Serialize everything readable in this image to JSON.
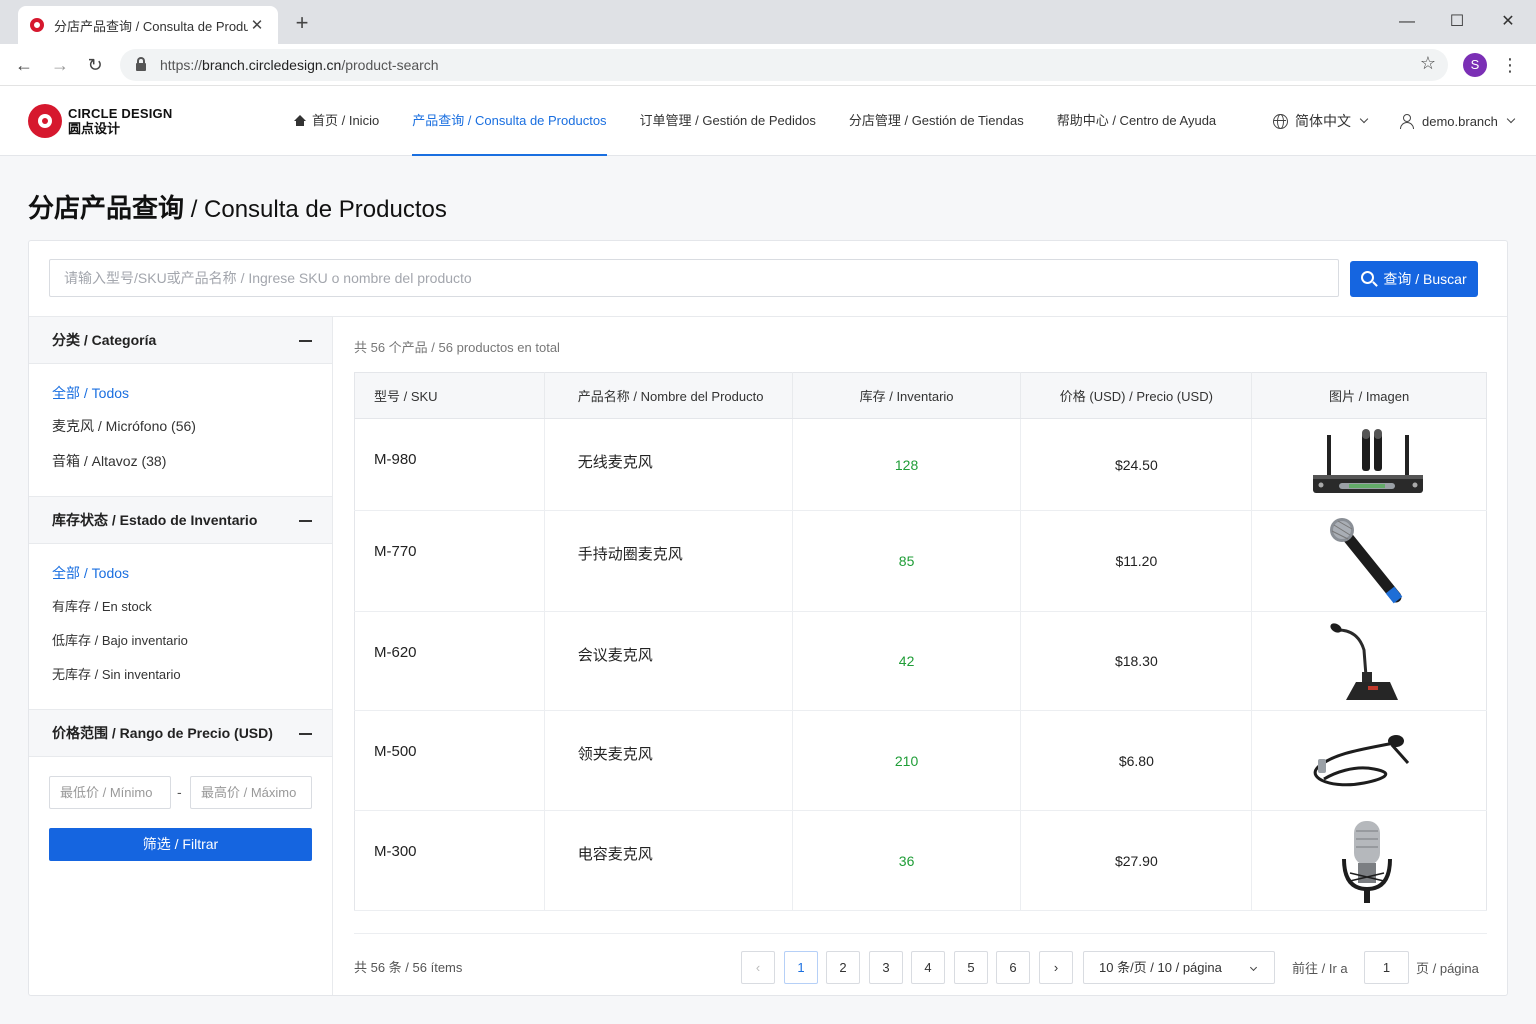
{
  "browser": {
    "tab_title": "分店产品查询 / Consulta de Productos",
    "url_prefix": "https://",
    "url_host": "branch.circledesign.cn",
    "url_path": "/product-search",
    "profile_initial": "S"
  },
  "header": {
    "logo_en": "CIRCLE DESIGN",
    "logo_zh": "圆点设计",
    "nav": [
      {
        "label": "首页 / Inicio"
      },
      {
        "label": "产品查询 / Consulta de Productos"
      },
      {
        "label": "订单管理 / Gestión de Pedidos"
      },
      {
        "label": "分店管理 / Gestión de Tiendas"
      },
      {
        "label": "帮助中心 / Centro de Ayuda"
      }
    ],
    "language": "简体中文",
    "user": "demo.branch"
  },
  "page": {
    "title_zh": "分店产品查询",
    "title_es": "/ Consulta de Productos"
  },
  "search": {
    "placeholder": "请输入型号/SKU或产品名称 / Ingrese SKU o nombre del producto",
    "button_label": "查询 / Buscar"
  },
  "filters": {
    "category": {
      "title": "分类 / Categoría",
      "options": [
        "全部 / Todos",
        "麦克风 / Micrófono (56)",
        "音箱 / Altavoz (38)"
      ]
    },
    "stock": {
      "title": "库存状态 / Estado de Inventario",
      "options": [
        "全部 / Todos",
        "有库存 / En stock",
        "低库存 / Bajo inventario",
        "无库存 / Sin inventario"
      ]
    },
    "price": {
      "title": "价格范围 / Rango de Precio (USD)",
      "min_placeholder": "最低价 / Mínimo",
      "max_placeholder": "最高价 / Máximo",
      "dash": "-",
      "button_label": "筛选 / Filtrar"
    }
  },
  "results": {
    "total_text": "共 56 个产品 / 56 productos en total",
    "columns": [
      "型号 / SKU",
      "产品名称 / Nombre del Producto",
      "库存 / Inventario",
      "价格 (USD) / Precio (USD)",
      "图片 / Imagen"
    ],
    "rows": [
      {
        "sku": "M-980",
        "name": "无线麦克风",
        "stock": "128",
        "price": "$24.50",
        "icon": "wireless-mic-receiver-icon"
      },
      {
        "sku": "M-770",
        "name": "手持动圈麦克风",
        "stock": "85",
        "price": "$11.20",
        "icon": "handheld-mic-icon"
      },
      {
        "sku": "M-620",
        "name": "会议麦克风",
        "stock": "42",
        "price": "$18.30",
        "icon": "conference-mic-icon"
      },
      {
        "sku": "M-500",
        "name": "领夹麦克风",
        "stock": "210",
        "price": "$6.80",
        "icon": "lavalier-mic-icon"
      },
      {
        "sku": "M-300",
        "name": "电容麦克风",
        "stock": "36",
        "price": "$27.90",
        "icon": "condenser-mic-icon"
      }
    ]
  },
  "pagination": {
    "total_text": "共 56 条 / 56 ítems",
    "pages": [
      "1",
      "2",
      "3",
      "4",
      "5",
      "6"
    ],
    "current": "1",
    "prev": "‹",
    "next": "›",
    "page_size": "10  条/页 / 10 / página",
    "goto_label": "前往 / Ir a",
    "goto_value": "1",
    "goto_suffix": "页 / página"
  },
  "colors": {
    "primary": "#1565e0",
    "brand_red": "#d6182e",
    "stock_green": "#1f9d37"
  }
}
